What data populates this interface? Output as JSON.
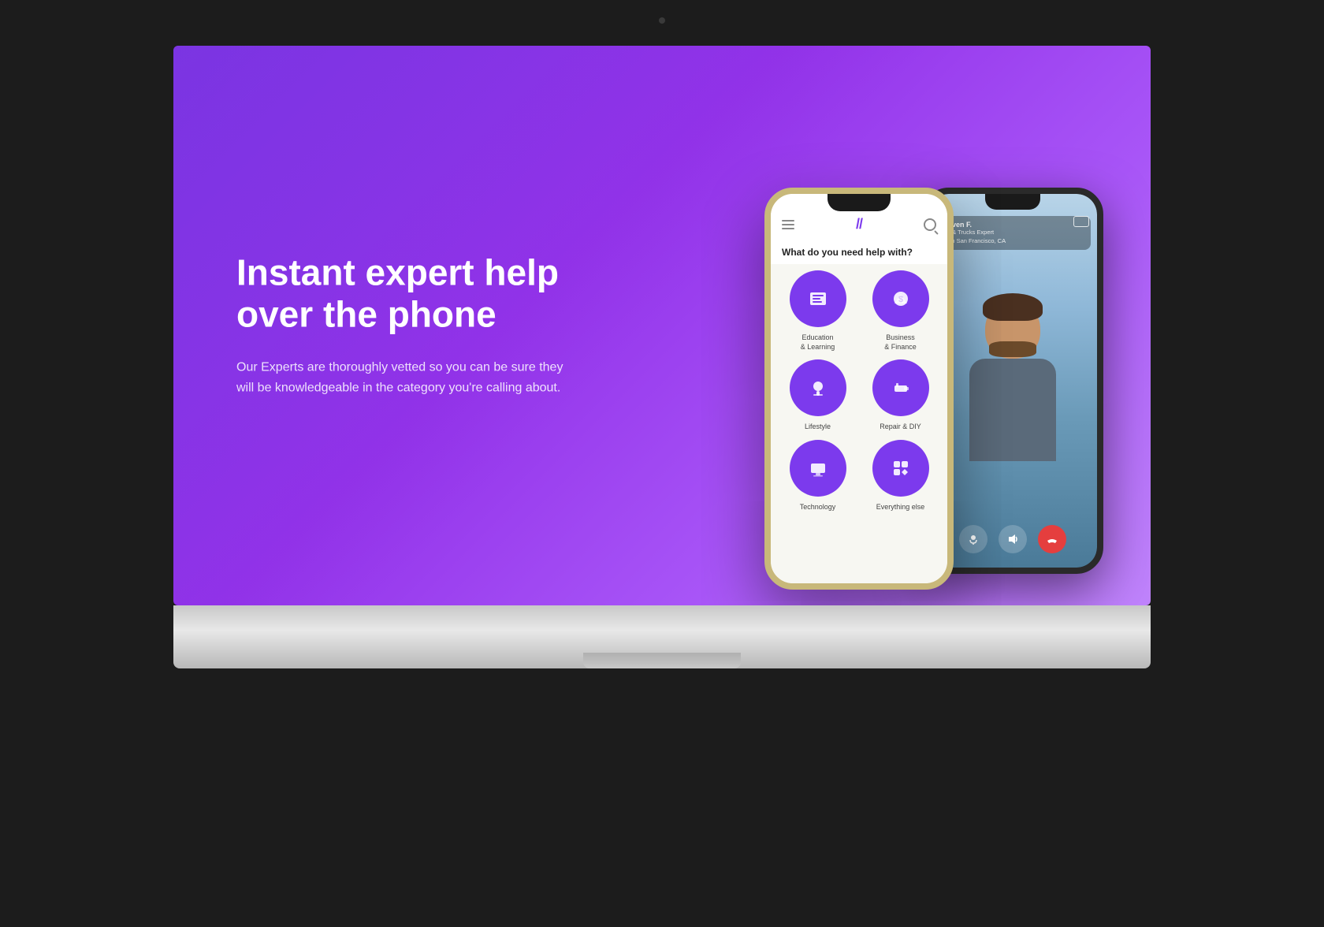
{
  "monitor": {
    "screen": {
      "hero": {
        "title": "Instant expert help over the phone",
        "subtitle": "Our Experts are thoroughly vetted so you can be sure they will be knowledgeable in the category you're calling about."
      },
      "phone_main": {
        "question": "What do you need help with?",
        "app_logo": "//",
        "categories": [
          {
            "id": "education",
            "label": "Education\n& Learning",
            "icon": "📚"
          },
          {
            "id": "business",
            "label": "Business\n& Finance",
            "icon": "💰"
          },
          {
            "id": "lifestyle",
            "label": "Lifestyle",
            "icon": "🎙"
          },
          {
            "id": "repair",
            "label": "Repair & DIY",
            "icon": "🔧"
          },
          {
            "id": "technology",
            "label": "Technology",
            "icon": "💻"
          },
          {
            "id": "everything",
            "label": "Everything else",
            "icon": "⊞"
          }
        ]
      },
      "phone_video": {
        "expert_name": "Steven F.",
        "expert_title": "Car & Trucks Expert",
        "expert_location": "From San Francisco, CA"
      }
    }
  }
}
